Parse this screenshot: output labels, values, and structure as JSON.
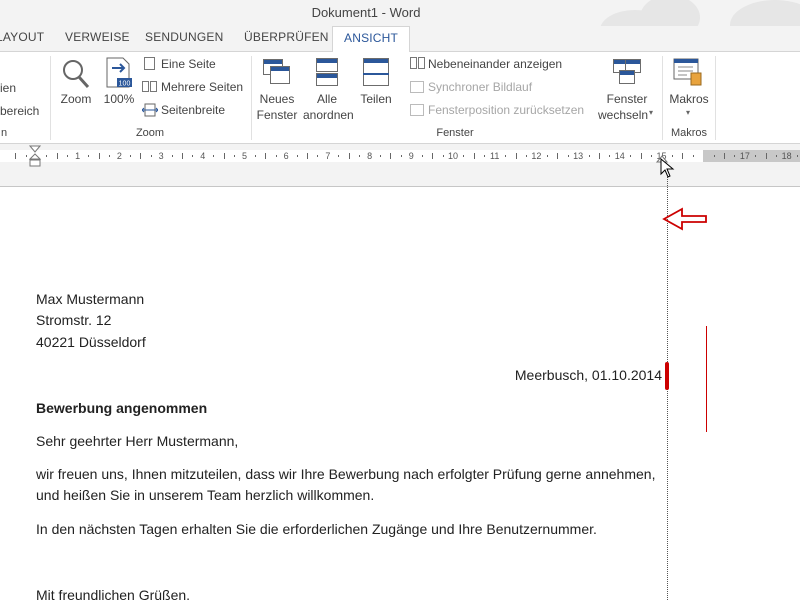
{
  "window": {
    "title": "Dokument1 - Word"
  },
  "tabs": [
    {
      "label": "LAYOUT",
      "active": false
    },
    {
      "label": "VERWEISE",
      "active": false
    },
    {
      "label": "SENDUNGEN",
      "active": false
    },
    {
      "label": "ÜBERPRÜFEN",
      "active": false
    },
    {
      "label": "ANSICHT",
      "active": true
    }
  ],
  "ribbon": {
    "partial_group": {
      "line1": "ien",
      "line2": "bereich",
      "group_label": "n"
    },
    "zoom_group": {
      "zoom": "Zoom",
      "percent": "100%",
      "percent_icon_text": "100",
      "one_page": "Eine Seite",
      "multiple_pages": "Mehrere Seiten",
      "page_width": "Seitenbreite",
      "group_label": "Zoom"
    },
    "window_group": {
      "new_window_line1": "Neues",
      "new_window_line2": "Fenster",
      "arrange_all_line1": "Alle",
      "arrange_all_line2": "anordnen",
      "split": "Teilen",
      "side_by_side": "Nebeneinander anzeigen",
      "sync_scroll": "Synchroner Bildlauf",
      "reset_position": "Fensterposition zurücksetzen",
      "switch_line1": "Fenster",
      "switch_line2": "wechseln",
      "group_label": "Fenster"
    },
    "macros_group": {
      "macros": "Makros",
      "group_label": "Makros"
    }
  },
  "ruler": {
    "numbers": [
      "1",
      "1",
      "2",
      "3",
      "4",
      "5",
      "6",
      "7",
      "8",
      "9",
      "10",
      "11",
      "12",
      "13",
      "14",
      "15",
      "17",
      "18"
    ]
  },
  "document": {
    "sender_name": "Max Mustermann",
    "sender_street": "Stromstr. 12",
    "sender_city": "40221 Düsseldorf",
    "date_line": "Meerbusch, 01.10.2014",
    "subject": "Bewerbung angenommen",
    "salutation": "Sehr geehrter Herr Mustermann,",
    "para1_line1": "wir freuen uns, Ihnen mitzuteilen, dass wir Ihre Bewerbung nach erfolgter Prüfung gerne annehmen,",
    "para1_line2": "und heißen Sie in unserem Team herzlich willkommen.",
    "para2": "In den nächsten Tagen erhalten Sie die erforderlichen Zugänge und Ihre Benutzernummer.",
    "closing": "Mit freundlichen Grüßen,"
  },
  "colors": {
    "accent": "#2b579a",
    "annotation_red": "#cc0000",
    "ribbon_bg": "#f3f3f3"
  }
}
